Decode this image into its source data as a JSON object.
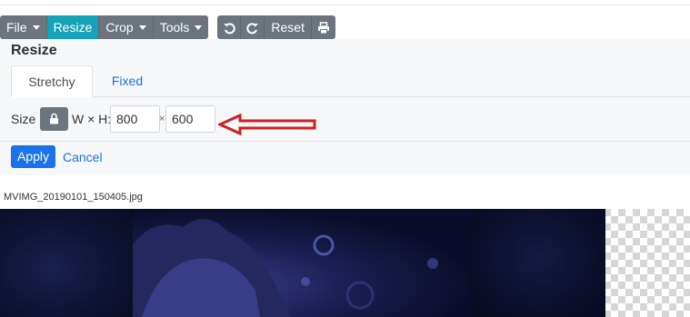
{
  "menubar": {
    "file": "File",
    "resize": "Resize",
    "crop": "Crop",
    "tools": "Tools",
    "reset": "Reset"
  },
  "panel": {
    "title": "Resize",
    "tabs": [
      {
        "label": "Stretchy",
        "active": true
      },
      {
        "label": "Fixed",
        "active": false
      }
    ],
    "size_label": "Size",
    "wh_label": "W × H:",
    "width_value": "800",
    "height_value": "600",
    "times_sign": "×",
    "apply": "Apply",
    "cancel": "Cancel"
  },
  "image": {
    "filename": "MVIMG_20190101_150405.jpg"
  },
  "colors": {
    "menu_gray": "#6c757d",
    "menu_active": "#17a2b8",
    "primary": "#1a73e8",
    "link": "#1a73d9",
    "annotation_arrow": "#d21f1f"
  },
  "icons": {
    "undo": "rotate-left-icon",
    "redo": "rotate-right-icon",
    "print": "print-icon",
    "lock": "lock-icon",
    "annotation": "arrow-left-annotation"
  }
}
